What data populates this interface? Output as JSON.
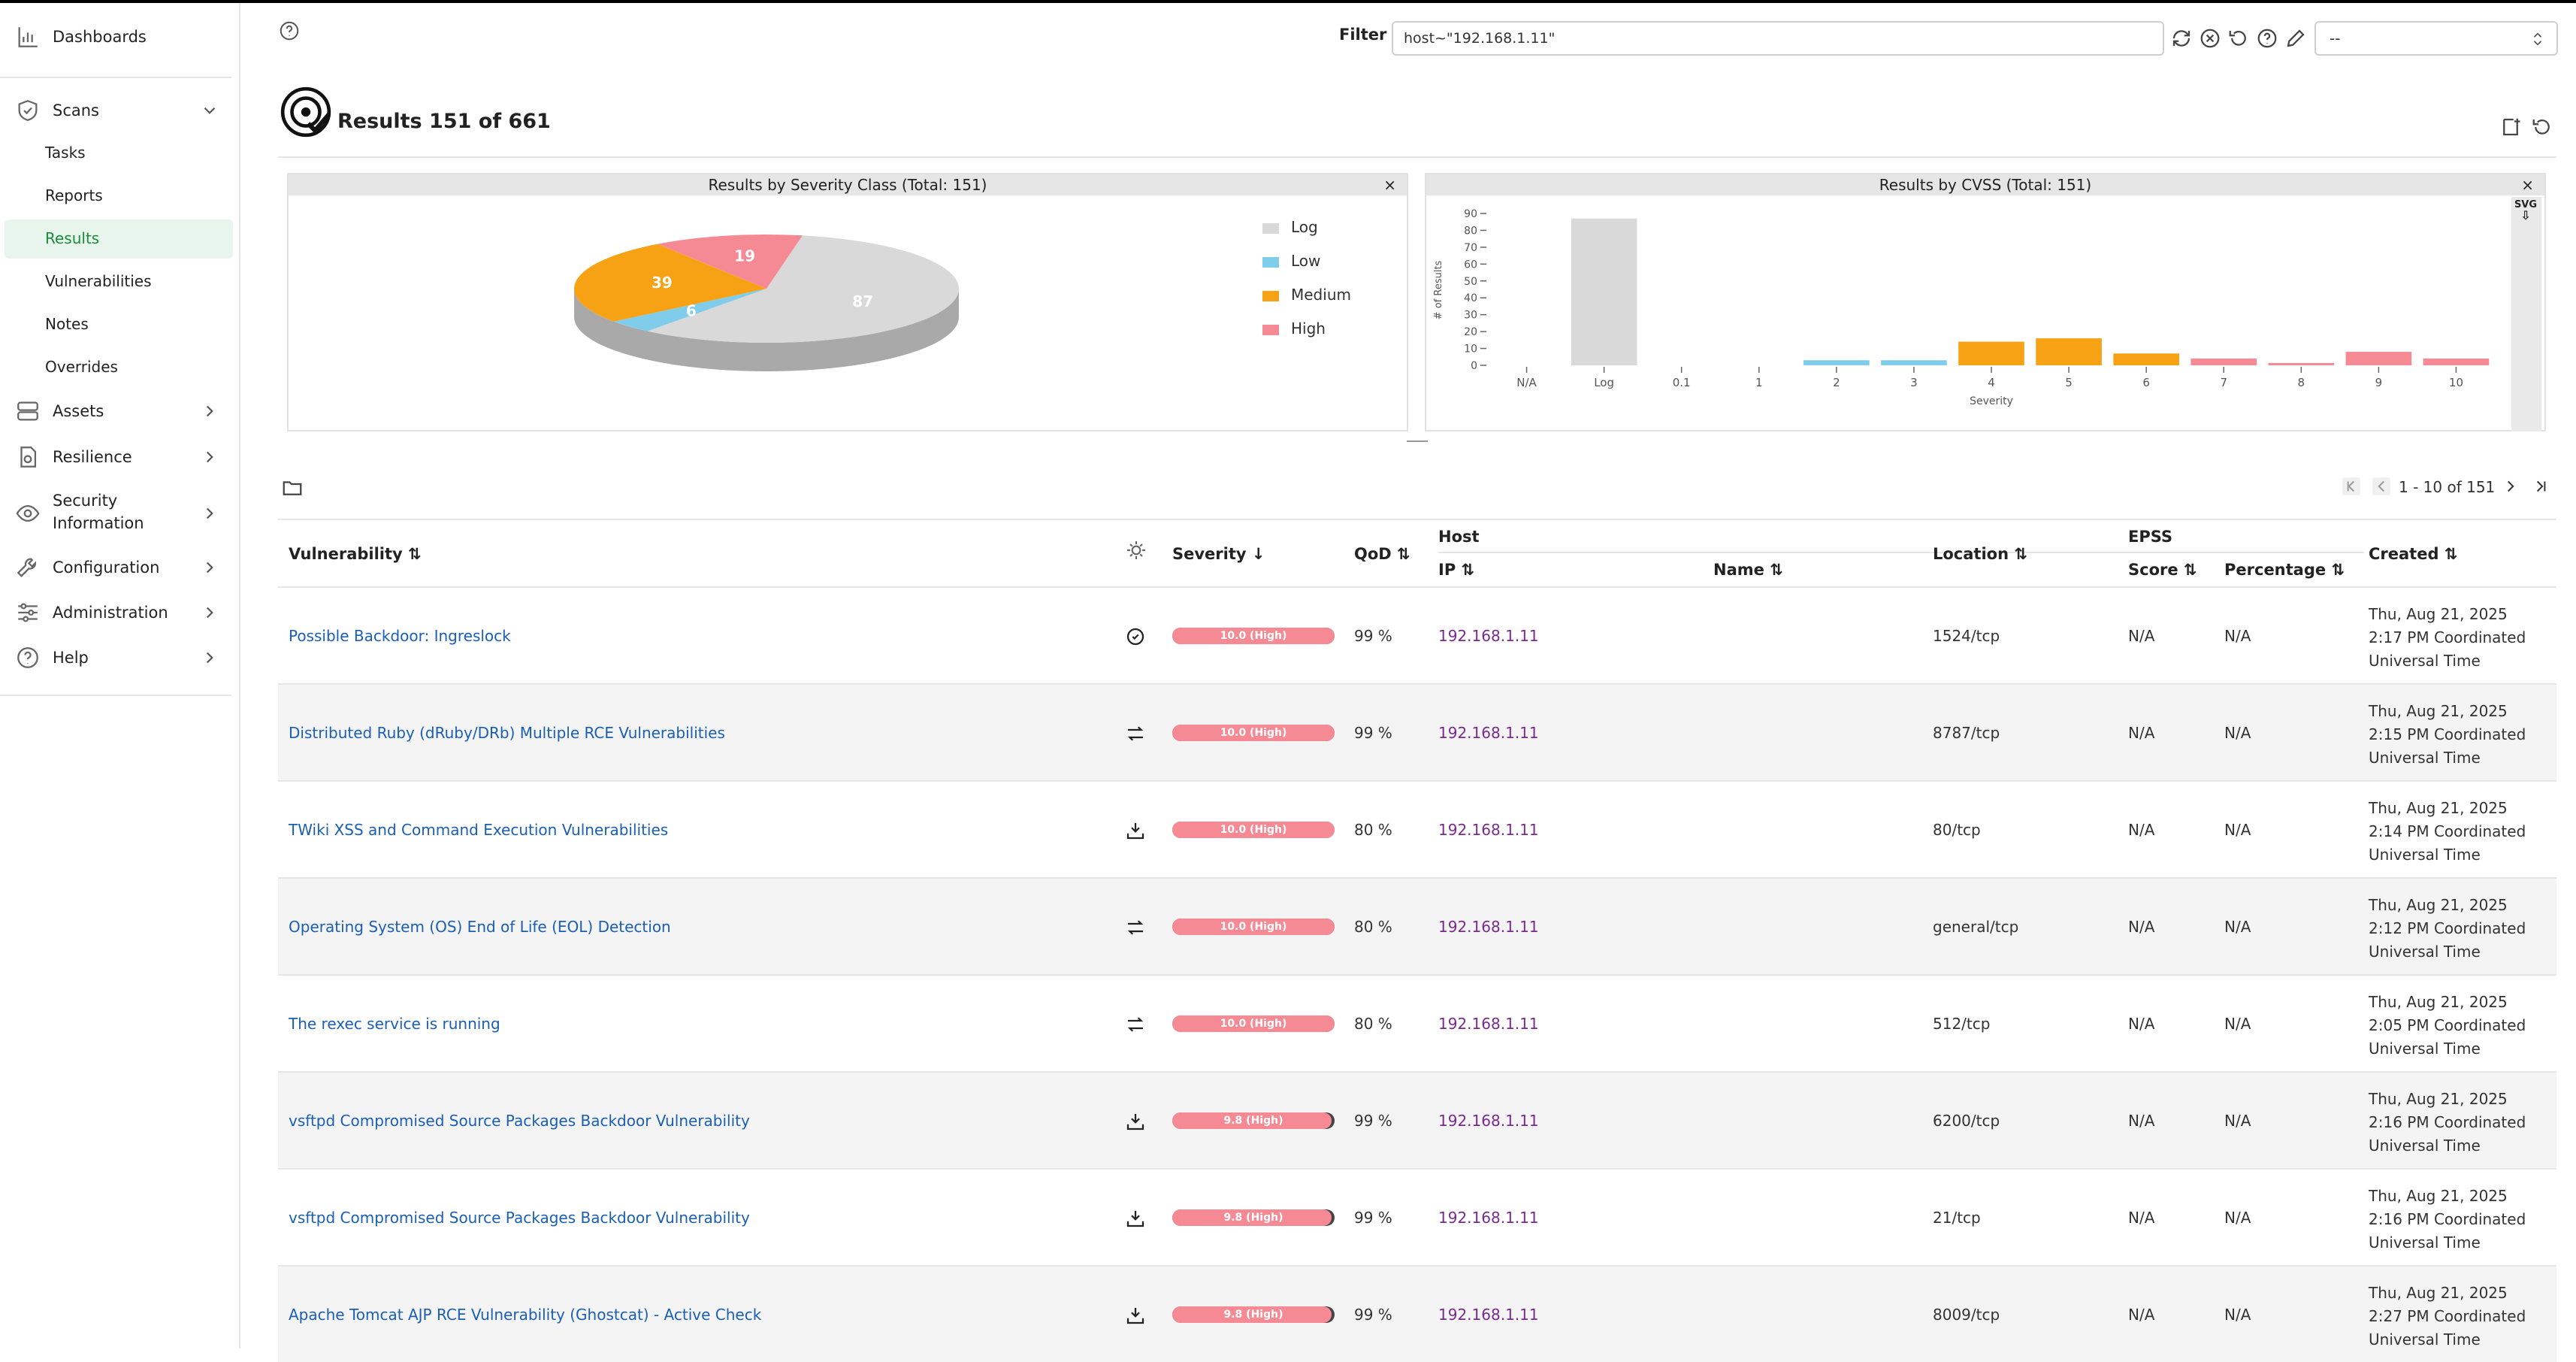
{
  "sidebar": {
    "dashboards": "Dashboards",
    "scans": "Scans",
    "sub": [
      "Tasks",
      "Reports",
      "Results",
      "Vulnerabilities",
      "Notes",
      "Overrides"
    ],
    "assets": "Assets",
    "resilience": "Resilience",
    "security_info_line1": "Security",
    "security_info_line2": "Information",
    "configuration": "Configuration",
    "administration": "Administration",
    "help": "Help"
  },
  "header": {
    "filter_label": "Filter",
    "filter_value": "host~\"192.168.1.11\"",
    "select_value": "--",
    "title": "Results 151 of 661"
  },
  "pie": {
    "title": "Results by Severity Class (Total: 151)",
    "close": "×",
    "legend": [
      {
        "label": "Log",
        "color": "#d9d9d9"
      },
      {
        "label": "Low",
        "color": "#7fcdea"
      },
      {
        "label": "Medium",
        "color": "#f6a214"
      },
      {
        "label": "High",
        "color": "#f58a94"
      }
    ],
    "slices": [
      {
        "label": "Log",
        "value": 87,
        "color": "#d9d9d9"
      },
      {
        "label": "Low",
        "value": 6,
        "color": "#7fcdea"
      },
      {
        "label": "Medium",
        "value": 39,
        "color": "#f6a214"
      },
      {
        "label": "High",
        "value": 19,
        "color": "#f58a94"
      }
    ],
    "value_labels": [
      "87",
      "6",
      "39",
      "19"
    ]
  },
  "bar": {
    "title": "Results by CVSS (Total: 151)",
    "close": "×",
    "svg_label": "SVG",
    "ylabel": "# of Results",
    "xlabel": "Severity",
    "yticks": [
      "0",
      "10",
      "20",
      "30",
      "40",
      "50",
      "60",
      "70",
      "80",
      "90"
    ],
    "categories": [
      "N/A",
      "Log",
      "0.1",
      "1",
      "2",
      "3",
      "4",
      "5",
      "6",
      "7",
      "8",
      "9",
      "10"
    ]
  },
  "chart_data": {
    "type": "bar",
    "title": "Results by CVSS (Total: 151)",
    "xlabel": "Severity",
    "ylabel": "# of Results",
    "categories": [
      "N/A",
      "Log",
      "0.1",
      "1",
      "2",
      "3",
      "4",
      "5",
      "6",
      "7",
      "8",
      "9",
      "10"
    ],
    "values": [
      0,
      87,
      0,
      0,
      3,
      3,
      14,
      16,
      7,
      4,
      1,
      8,
      4
    ],
    "colors": [
      "#d9d9d9",
      "#d9d9d9",
      "#7fcdea",
      "#7fcdea",
      "#7fcdea",
      "#7fcdea",
      "#f6a214",
      "#f6a214",
      "#f6a214",
      "#f58a94",
      "#f58a94",
      "#f58a94",
      "#f58a94"
    ],
    "ylim": [
      0,
      90
    ]
  },
  "pagination": {
    "text": "1 - 10 of 151"
  },
  "table": {
    "headers": {
      "vulnerability": "Vulnerability",
      "severity": "Severity",
      "qod": "QoD",
      "host": "Host",
      "ip": "IP",
      "name": "Name",
      "location": "Location",
      "epss": "EPSS",
      "score": "Score",
      "percentage": "Percentage",
      "created": "Created"
    },
    "rows": [
      {
        "vuln": "Possible Backdoor: Ingreslock",
        "sev": "10.0 (High)",
        "sev_fill": 1.0,
        "qod": "99 %",
        "ip": "192.168.1.11",
        "loc": "1524/tcp",
        "score": "N/A",
        "pct": "N/A",
        "c1": "Thu, Aug 21, 2025",
        "c2": "2:17 PM Coordinated",
        "c3": "Universal Time",
        "icon": "refresh-check-icon"
      },
      {
        "vuln": "Distributed Ruby (dRuby/DRb) Multiple RCE Vulnerabilities",
        "sev": "10.0 (High)",
        "sev_fill": 1.0,
        "qod": "99 %",
        "ip": "192.168.1.11",
        "loc": "8787/tcp",
        "score": "N/A",
        "pct": "N/A",
        "c1": "Thu, Aug 21, 2025",
        "c2": "2:15 PM Coordinated",
        "c3": "Universal Time",
        "icon": "mitigation-icon"
      },
      {
        "vuln": "TWiki XSS and Command Execution Vulnerabilities",
        "sev": "10.0 (High)",
        "sev_fill": 1.0,
        "qod": "80 %",
        "ip": "192.168.1.11",
        "loc": "80/tcp",
        "score": "N/A",
        "pct": "N/A",
        "c1": "Thu, Aug 21, 2025",
        "c2": "2:14 PM Coordinated",
        "c3": "Universal Time",
        "icon": "vendor-fix-icon"
      },
      {
        "vuln": "Operating System (OS) End of Life (EOL) Detection",
        "sev": "10.0 (High)",
        "sev_fill": 1.0,
        "qod": "80 %",
        "ip": "192.168.1.11",
        "loc": "general/tcp",
        "score": "N/A",
        "pct": "N/A",
        "c1": "Thu, Aug 21, 2025",
        "c2": "2:12 PM Coordinated",
        "c3": "Universal Time",
        "icon": "mitigation-icon"
      },
      {
        "vuln": "The rexec service is running",
        "sev": "10.0 (High)",
        "sev_fill": 1.0,
        "qod": "80 %",
        "ip": "192.168.1.11",
        "loc": "512/tcp",
        "score": "N/A",
        "pct": "N/A",
        "c1": "Thu, Aug 21, 2025",
        "c2": "2:05 PM Coordinated",
        "c3": "Universal Time",
        "icon": "mitigation-icon"
      },
      {
        "vuln": "vsftpd Compromised Source Packages Backdoor Vulnerability",
        "sev": "9.8 (High)",
        "sev_fill": 0.98,
        "qod": "99 %",
        "ip": "192.168.1.11",
        "loc": "6200/tcp",
        "score": "N/A",
        "pct": "N/A",
        "c1": "Thu, Aug 21, 2025",
        "c2": "2:16 PM Coordinated",
        "c3": "Universal Time",
        "icon": "vendor-fix-icon"
      },
      {
        "vuln": "vsftpd Compromised Source Packages Backdoor Vulnerability",
        "sev": "9.8 (High)",
        "sev_fill": 0.98,
        "qod": "99 %",
        "ip": "192.168.1.11",
        "loc": "21/tcp",
        "score": "N/A",
        "pct": "N/A",
        "c1": "Thu, Aug 21, 2025",
        "c2": "2:16 PM Coordinated",
        "c3": "Universal Time",
        "icon": "vendor-fix-icon"
      },
      {
        "vuln": "Apache Tomcat AJP RCE Vulnerability (Ghostcat) - Active Check",
        "sev": "9.8 (High)",
        "sev_fill": 0.98,
        "qod": "99 %",
        "ip": "192.168.1.11",
        "loc": "8009/tcp",
        "score": "N/A",
        "pct": "N/A",
        "c1": "Thu, Aug 21, 2025",
        "c2": "2:27 PM Coordinated",
        "c3": "Universal Time",
        "icon": "vendor-fix-icon"
      }
    ]
  }
}
